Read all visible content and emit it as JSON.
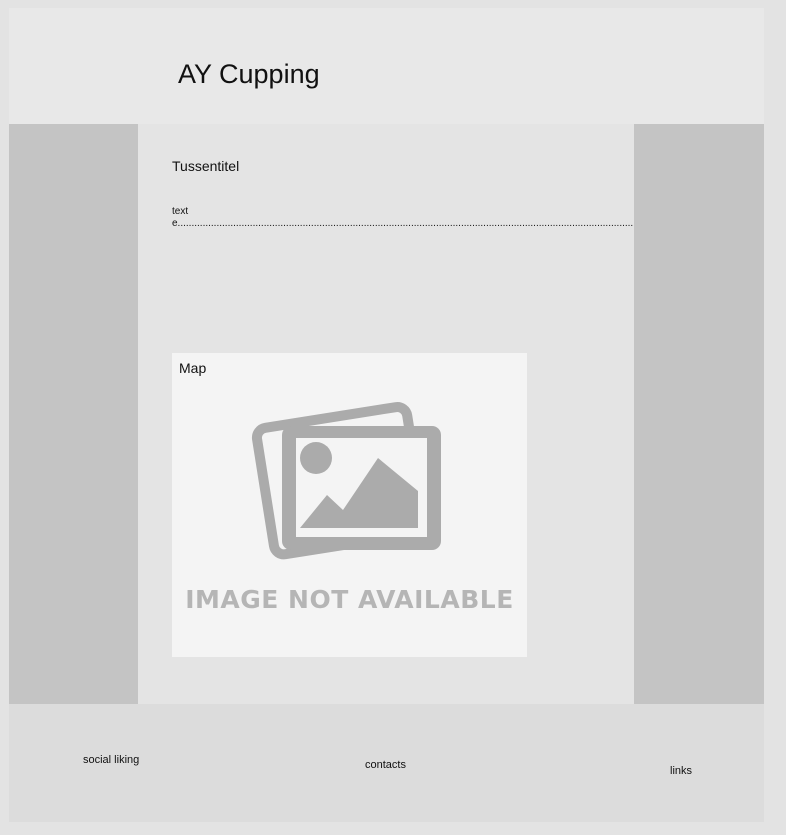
{
  "header": {
    "site_title": "AY Cupping"
  },
  "main": {
    "subtitle": "Tussentitel",
    "body_text": "texte..................................................................................................................................................................................................................",
    "map": {
      "label": "Map",
      "placeholder_text": "IMAGE NOT AVAILABLE"
    }
  },
  "footer": {
    "social": "social liking",
    "contacts": "contacts",
    "links": "links"
  },
  "colors": {
    "header_bg": "#e8e8e8",
    "sidebar_bg": "#c4c4c4",
    "content_bg": "#e4e4e4",
    "footer_bg": "#dcdcdc",
    "map_bg": "#f4f4f4",
    "placeholder_gray": "#ababab"
  }
}
